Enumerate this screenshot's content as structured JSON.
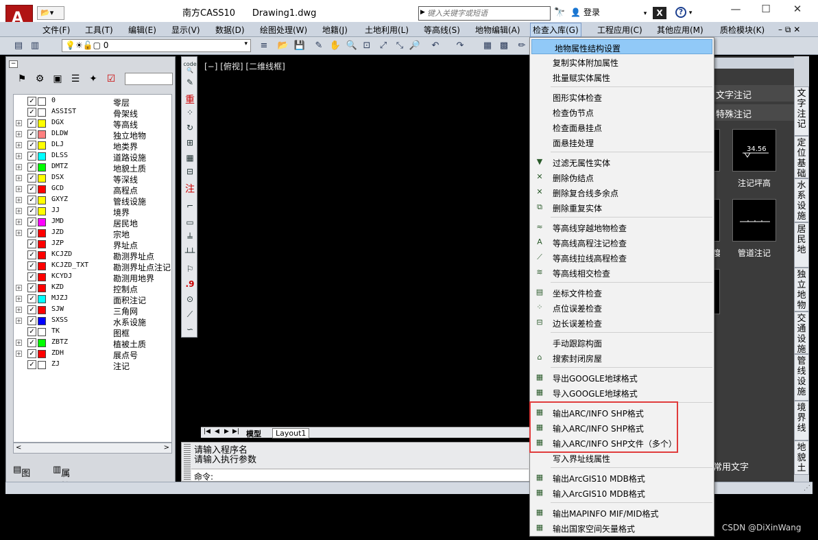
{
  "titlebar": {
    "app_name": "南方CASS10",
    "document": "Drawing1.dwg",
    "search_placeholder": "键入关键字或短语",
    "login_label": "登录",
    "window_buttons": [
      "minimize-icon",
      "maximize-icon",
      "close-icon"
    ]
  },
  "menubar": {
    "items": [
      "文件(F)",
      "工具(T)",
      "编辑(E)",
      "显示(V)",
      "数据(D)",
      "绘图处理(W)",
      "地籍(J)",
      "土地利用(L)",
      "等高线(S)",
      "地物编辑(A)",
      "检查入库(G)",
      "工程应用(C)",
      "其他应用(M)",
      "质检模块(K)"
    ],
    "active": "检查入库(G)"
  },
  "toolbar": {
    "layer_value": "0"
  },
  "layer_panel": {
    "rows": [
      {
        "name": "0",
        "desc": "零层",
        "color": "#ffffff",
        "expandable": false
      },
      {
        "name": "ASSIST",
        "desc": "骨架线",
        "color": "#ffffff",
        "expandable": false
      },
      {
        "name": "DGX",
        "desc": "等高线",
        "color": "#ffff00",
        "expandable": true
      },
      {
        "name": "DLDW",
        "desc": "独立地物",
        "color": "#ff8080",
        "expandable": true
      },
      {
        "name": "DLJ",
        "desc": "地类界",
        "color": "#ffff00",
        "expandable": true
      },
      {
        "name": "DLSS",
        "desc": "道路设施",
        "color": "#00ffff",
        "expandable": true
      },
      {
        "name": "DMTZ",
        "desc": "地貌土质",
        "color": "#00ff00",
        "expandable": true
      },
      {
        "name": "DSX",
        "desc": "等深线",
        "color": "#ffff00",
        "expandable": true
      },
      {
        "name": "GCD",
        "desc": "高程点",
        "color": "#ff0000",
        "expandable": true
      },
      {
        "name": "GXYZ",
        "desc": "管线设施",
        "color": "#ffff00",
        "expandable": true
      },
      {
        "name": "JJ",
        "desc": "境界",
        "color": "#ffff00",
        "expandable": true
      },
      {
        "name": "JMD",
        "desc": "居民地",
        "color": "#ff00ff",
        "expandable": true
      },
      {
        "name": "JZD",
        "desc": "宗地",
        "color": "#ff0000",
        "expandable": true
      },
      {
        "name": "JZP",
        "desc": "界址点",
        "color": "#ff0000",
        "expandable": false
      },
      {
        "name": "KCJZD",
        "desc": "勘测界址点",
        "color": "#ff0000",
        "expandable": false
      },
      {
        "name": "KCJZD_TXT",
        "desc": "勘测界址点注记",
        "color": "#ff0000",
        "expandable": false
      },
      {
        "name": "KCYDJ",
        "desc": "勘测用地界",
        "color": "#ff0000",
        "expandable": false
      },
      {
        "name": "KZD",
        "desc": "控制点",
        "color": "#ff0000",
        "expandable": true
      },
      {
        "name": "MJZJ",
        "desc": "面积注记",
        "color": "#00ffff",
        "expandable": true
      },
      {
        "name": "SJW",
        "desc": "三角网",
        "color": "#ff0000",
        "expandable": true
      },
      {
        "name": "SXSS",
        "desc": "水系设施",
        "color": "#0000ff",
        "expandable": true
      },
      {
        "name": "TK",
        "desc": "图框",
        "color": "#ffffff",
        "expandable": false
      },
      {
        "name": "ZBTZ",
        "desc": "植被土质",
        "color": "#00ff00",
        "expandable": true
      },
      {
        "name": "ZDH",
        "desc": "展点号",
        "color": "#ff0000",
        "expandable": true
      },
      {
        "name": "ZJ",
        "desc": "注记",
        "color": "#ffffff",
        "expandable": false
      }
    ],
    "tab_layers": "图层",
    "tab_props": "属性"
  },
  "drawing": {
    "viewport_label": "[−] [俯视] [二维线框]",
    "tab_model": "模型",
    "tab_layout": "Layout1"
  },
  "command": {
    "line1": "请输入程序名",
    "line2": "请输入执行参数",
    "prompt": "命令:"
  },
  "right_panel": {
    "hdr1": "文字注记",
    "hdr2": "特殊注记",
    "sym1_text": "34.56",
    "sym1_label": "注记坪高",
    "sym2_label": "管道注记",
    "partial_label": "度",
    "common_text": "常用文字",
    "vtabs": [
      "文字注记",
      "定位基础",
      "水系设施",
      "居民地",
      "独立地物",
      "交通设施",
      "管线设施",
      "境界线",
      "地貌土"
    ]
  },
  "dropdown": {
    "items": [
      {
        "label": "地物属性结构设置",
        "icon": "",
        "highlight": true
      },
      {
        "label": "复制实体附加属性",
        "icon": ""
      },
      {
        "label": "批量赋实体属性",
        "icon": ""
      },
      {
        "sep": true
      },
      {
        "label": "图形实体检查",
        "icon": ""
      },
      {
        "label": "检查伪节点",
        "icon": ""
      },
      {
        "label": "检查面悬挂点",
        "icon": ""
      },
      {
        "label": "面悬挂处理",
        "icon": ""
      },
      {
        "sep": true
      },
      {
        "label": "过滤无属性实体",
        "icon": "filter-icon"
      },
      {
        "label": "删除伪结点",
        "icon": "delete-node-icon"
      },
      {
        "label": "删除复合线多余点",
        "icon": "delete-vertex-icon"
      },
      {
        "label": "删除重复实体",
        "icon": "delete-duplicate-icon"
      },
      {
        "sep": true
      },
      {
        "label": "等高线穿越地物检查",
        "icon": "contour-check-icon"
      },
      {
        "label": "等高线高程注记检查",
        "icon": "contour-elevation-icon"
      },
      {
        "label": "等高线拉线高程检查",
        "icon": "contour-pull-icon"
      },
      {
        "label": "等高线相交检查",
        "icon": "contour-intersect-icon"
      },
      {
        "sep": true
      },
      {
        "label": "坐标文件检查",
        "icon": "coord-file-icon"
      },
      {
        "label": "点位误差检查",
        "icon": "point-error-icon"
      },
      {
        "label": "边长误差检查",
        "icon": "edge-error-icon"
      },
      {
        "sep": true
      },
      {
        "label": "手动跟踪构面",
        "icon": ""
      },
      {
        "label": "搜索封闭房屋",
        "icon": "house-icon"
      },
      {
        "sep": true
      },
      {
        "label": "导出GOOGLE地球格式",
        "icon": "export-kml-icon"
      },
      {
        "label": "导入GOOGLE地球格式",
        "icon": "import-kml-icon"
      },
      {
        "sep": true
      },
      {
        "label": "输出ARC/INFO SHP格式",
        "icon": "export-shp-icon"
      },
      {
        "label": "输入ARC/INFO SHP格式",
        "icon": "import-shp-icon"
      },
      {
        "label": "输入ARC/INFO SHP文件（多个）",
        "icon": "import-shp-multi-icon"
      },
      {
        "label": "写入界址线属性",
        "icon": ""
      },
      {
        "sep": true
      },
      {
        "label": "输出ArcGIS10 MDB格式",
        "icon": "export-mdb-icon"
      },
      {
        "label": "输入ArcGIS10 MDB格式",
        "icon": "import-mdb-icon"
      },
      {
        "sep": true
      },
      {
        "label": "输出MAPINFO MIF/MID格式",
        "icon": "export-mif-icon"
      },
      {
        "label": "输出国家空间矢量格式",
        "icon": "export-vct-icon"
      }
    ]
  },
  "watermark": "CSDN @DiXinWang",
  "colors": {
    "highlight": "#91c9f7",
    "redbox": "#e03b3b",
    "menubar": "#cdd5e0"
  }
}
